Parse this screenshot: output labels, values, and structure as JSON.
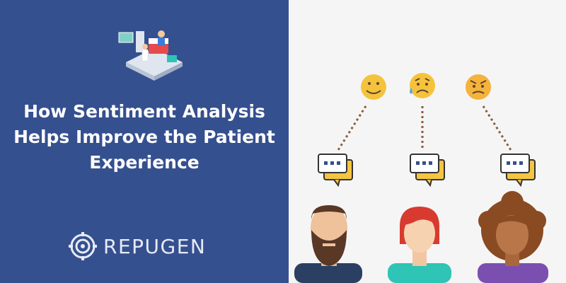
{
  "headline": {
    "line1": "How Sentiment Analysis",
    "line2": "Helps Improve the Patient",
    "line3": "Experience"
  },
  "brand": {
    "name": "REPUGEN",
    "logo_icon": "repugen-logo-icon"
  },
  "illustration": {
    "header_icon": "hospital-patient-illustration",
    "emojis": [
      "happy-face-icon",
      "sad-face-icon",
      "angry-face-icon"
    ],
    "bubbles": [
      "chat-bubble-icon",
      "chat-bubble-icon",
      "chat-bubble-icon"
    ],
    "people": [
      "bearded-man-avatar",
      "red-hair-woman-avatar",
      "curly-hair-woman-avatar"
    ]
  },
  "colors": {
    "left_panel": "#35508f",
    "right_panel": "#f5f5f5",
    "emoji_yellow": "#f5c33b",
    "dotted_line": "#8b5a3c",
    "bubble_yellow": "#f4c542"
  }
}
